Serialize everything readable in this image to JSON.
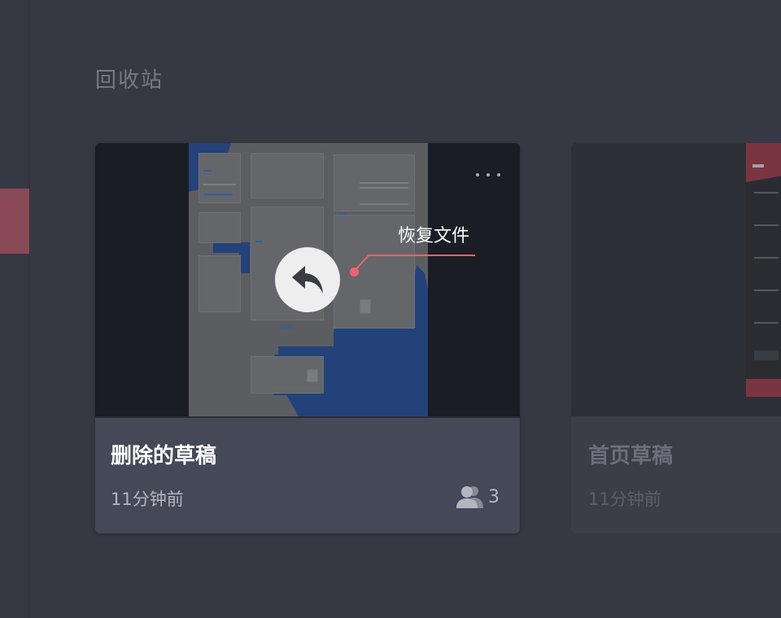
{
  "page": {
    "title": "回收站"
  },
  "cards": [
    {
      "title": "删除的草稿",
      "time": "11分钟前",
      "members": "3",
      "restore_label": "恢复文件"
    },
    {
      "title": "首页草稿",
      "time": "11分钟前"
    }
  ],
  "colors": {
    "accent": "#f2626e",
    "background": "#363944",
    "card": "#454857"
  },
  "icons": {
    "restore": "undo-arrow-icon",
    "more": "more-dots-icon",
    "members": "users-icon"
  }
}
